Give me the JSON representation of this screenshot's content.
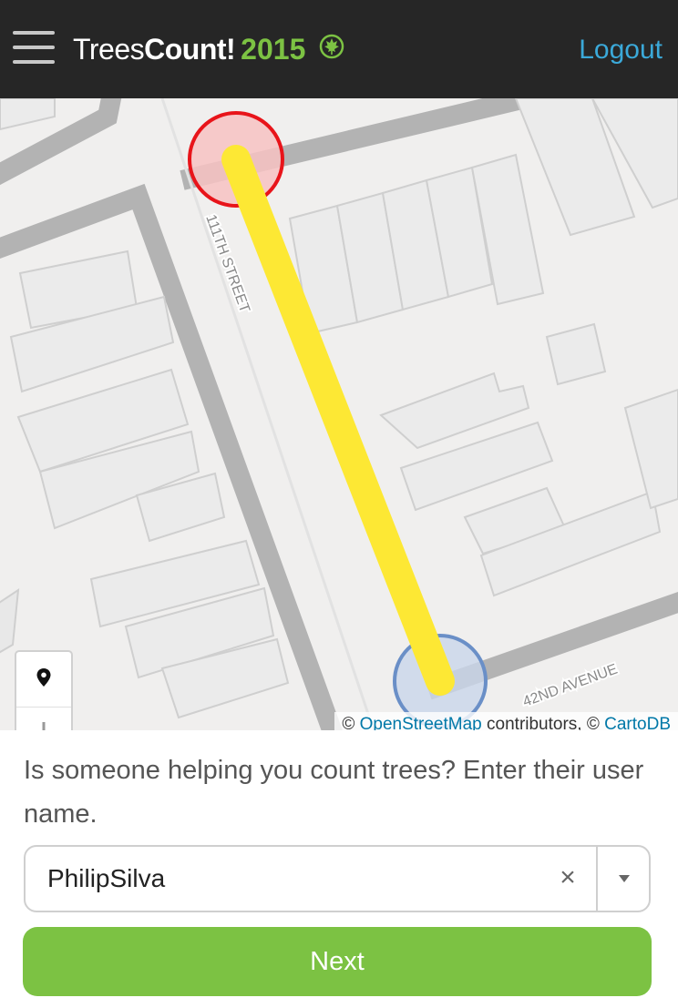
{
  "header": {
    "brand_part1": "Trees",
    "brand_part2": "Count!",
    "brand_year": "2015",
    "logout_label": "Logout",
    "menu_icon": "hamburger-menu-icon",
    "leaf_icon": "maple-leaf-icon",
    "brand_accent_color": "#7cc243",
    "link_color": "#3ba9d9"
  },
  "map": {
    "street_label_1": "111TH STREET",
    "street_label_2": "42ND AVENUE",
    "attribution": {
      "prefix": "© ",
      "osm_link": "OpenStreetMap",
      "middle": " contributors, © ",
      "carto_link": "CartoDB"
    },
    "controls": {
      "locate_icon": "map-pin-icon",
      "zoom_in_icon": "plus-icon",
      "zoom_out_icon": "minus-icon"
    },
    "route_color": "#fde834",
    "start_marker_color": "#e8141a",
    "end_marker_color": "#6a8fc7"
  },
  "form": {
    "question": "Is someone helping you count trees? Enter their user name.",
    "selected_user": "PhilipSilva",
    "clear_symbol": "×",
    "next_label": "Next",
    "button_color": "#7cc243"
  }
}
